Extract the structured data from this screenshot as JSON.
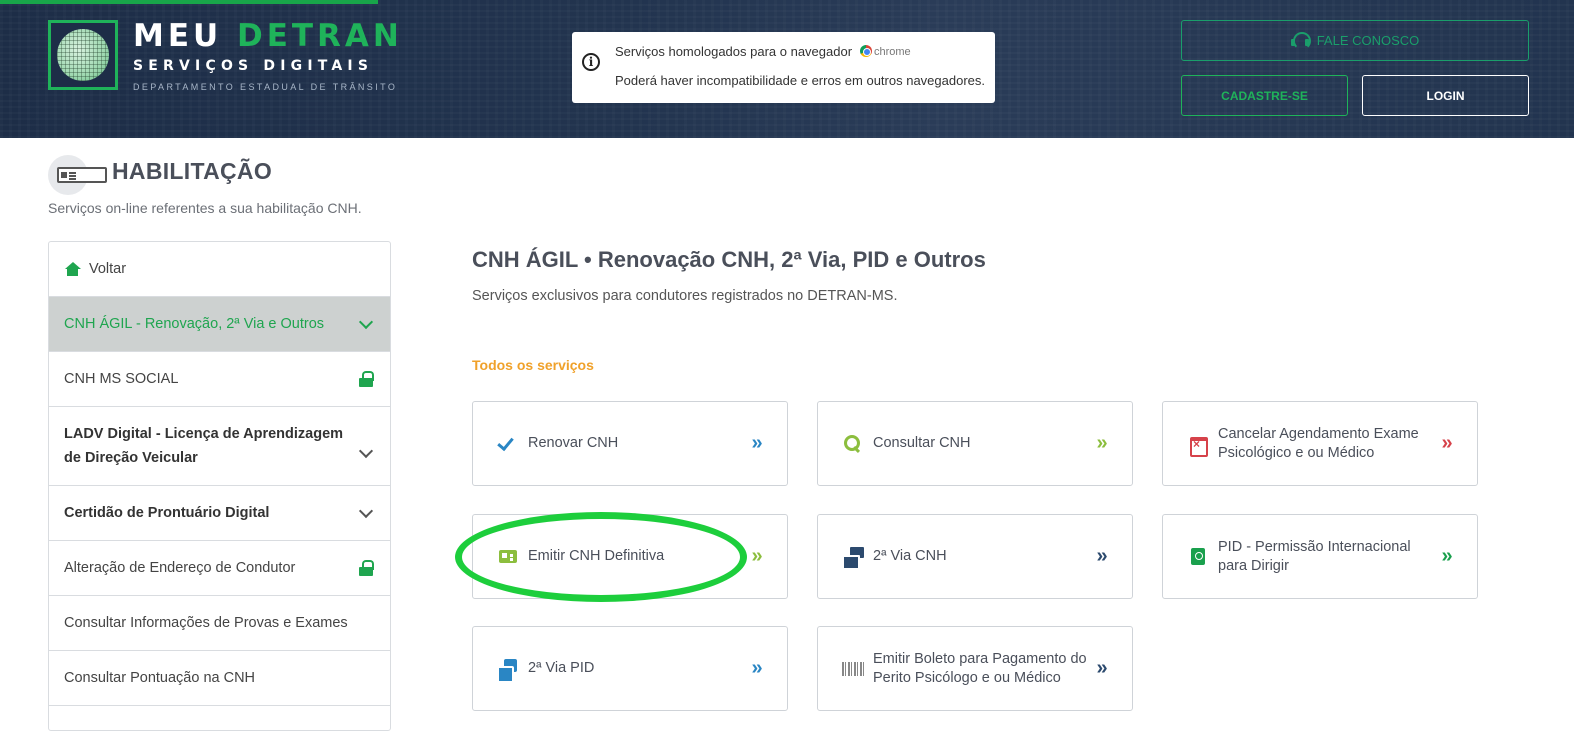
{
  "header": {
    "brand_meu": "MEU",
    "brand_detran": "DETRAN",
    "brand_sub": "SERVIÇOS DIGITAIS",
    "brand_dept": "DEPARTAMENTO ESTADUAL DE TRÂNSITO",
    "notice_line1": "Serviços homologados para o navegador",
    "notice_browser": "chrome",
    "notice_line2": "Poderá haver incompatibilidade e erros em outros navegadores.",
    "fale_conosco": "FALE CONOSCO",
    "cadastre_se": "CADASTRE-SE",
    "login": "LOGIN"
  },
  "page": {
    "title": "HABILITAÇÃO",
    "subtitle": "Serviços on-line referentes a sua habilitação CNH."
  },
  "sidebar": {
    "items": [
      {
        "label": "Voltar"
      },
      {
        "label": "CNH ÁGIL - Renovação, 2ª Via e Outros"
      },
      {
        "label": "CNH MS SOCIAL"
      },
      {
        "label": "LADV Digital - Licença de Aprendizagem de Direção Veicular"
      },
      {
        "label": "Certidão de Prontuário Digital"
      },
      {
        "label": "Alteração de Endereço de Condutor"
      },
      {
        "label": "Consultar Informações de Provas e Exames"
      },
      {
        "label": "Consultar Pontuação na CNH"
      }
    ]
  },
  "main": {
    "title": "CNH ÁGIL • Renovação CNH, 2ª Via, PID e Outros",
    "subtitle": "Serviços exclusivos para condutores registrados no DETRAN-MS.",
    "section_label": "Todos os serviços",
    "cards": [
      {
        "label": "Renovar CNH",
        "icon": "check-icon",
        "arrow_color": "#2a86c4"
      },
      {
        "label": "Consultar CNH",
        "icon": "search-icon",
        "arrow_color": "#8cbe3e"
      },
      {
        "label": "Cancelar Agendamento Exame Psicológico e ou Médico",
        "icon": "calendar-cancel-icon",
        "arrow_color": "#d6424a"
      },
      {
        "label": "Emitir CNH Definitiva",
        "icon": "id-card-icon",
        "arrow_color": "#8cbe3e"
      },
      {
        "label": "2ª Via CNH",
        "icon": "cards-icon",
        "arrow_color": "#2c4a6e"
      },
      {
        "label": "PID - Permissão Internacional para Dirigir",
        "icon": "passport-icon",
        "arrow_color": "#1aa04d"
      },
      {
        "label": "2ª Via PID",
        "icon": "passport-copy-icon",
        "arrow_color": "#2a86c4"
      },
      {
        "label": "Emitir Boleto para Pagamento do Perito Psicólogo e ou Médico",
        "icon": "barcode-icon",
        "arrow_color": "#2c4a6e"
      }
    ],
    "arrow_glyph": "»"
  },
  "colors": {
    "header_bg": "#1d2d47",
    "brand_green": "#1fb35a",
    "section_orange": "#f0a12a",
    "highlight_green": "#1dce3c"
  }
}
